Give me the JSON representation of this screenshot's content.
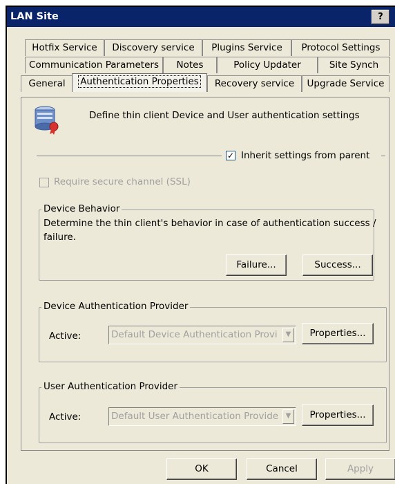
{
  "window": {
    "title": "LAN Site",
    "help_label": "?"
  },
  "tabs": {
    "row1": [
      "Hotfix Service",
      "Discovery service",
      "Plugins Service",
      "Protocol Settings"
    ],
    "row2": [
      "Communication Parameters",
      "Notes",
      "Policy Updater",
      "Site Synch"
    ],
    "row3": [
      "General",
      "Authentication Properties",
      "Recovery service",
      "Upgrade Service"
    ],
    "active": "Authentication Properties"
  },
  "panel": {
    "header_text": "Define thin client Device and User authentication settings",
    "inherit_label": "Inherit settings from parent",
    "inherit_checked": true,
    "ssl_label": "Require secure channel (SSL)",
    "device_behavior": {
      "title": "Device Behavior",
      "description_line1": "Determine the thin client's behavior in case of authentication success /",
      "description_line2": "failure.",
      "failure_button": "Failure...",
      "success_button": "Success..."
    },
    "device_auth": {
      "title": "Device Authentication Provider",
      "active_label": "Active:",
      "provider_value": "Default Device Authentication Provi",
      "properties_button": "Properties..."
    },
    "user_auth": {
      "title": "User Authentication Provider",
      "active_label": "Active:",
      "provider_value": "Default User Authentication Provide",
      "properties_button": "Properties..."
    }
  },
  "footer": {
    "ok_label": "OK",
    "cancel_label": "Cancel",
    "apply_label": "Apply"
  }
}
